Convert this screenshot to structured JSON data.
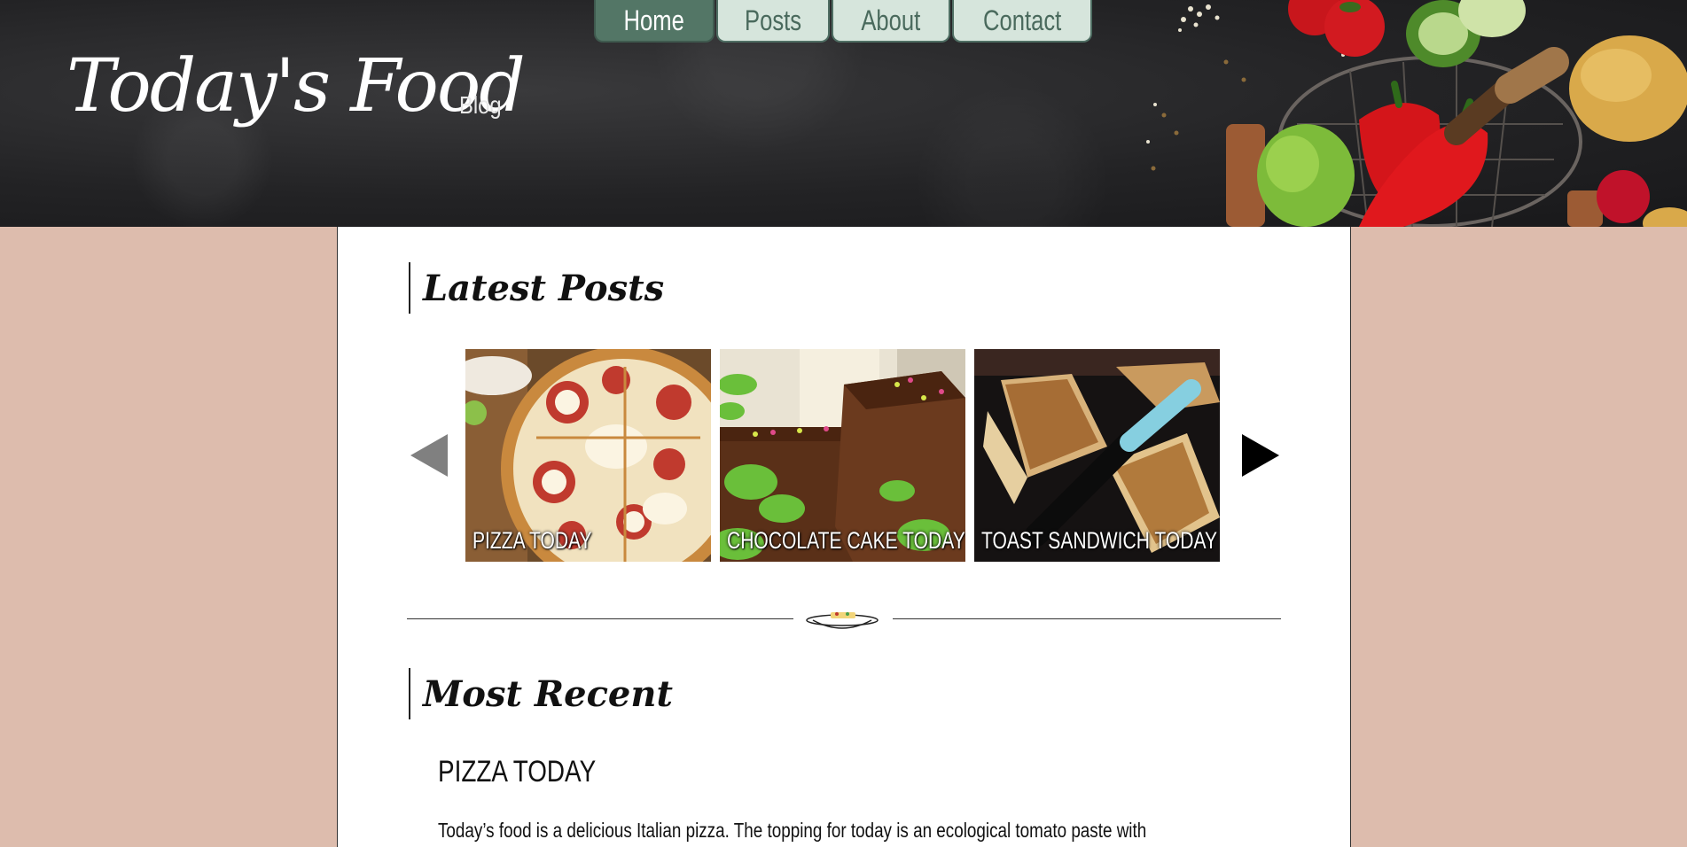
{
  "header": {
    "title": "Today's Food",
    "subtitle": "Blog",
    "nav": [
      {
        "label": "Home",
        "active": true
      },
      {
        "label": "Posts",
        "active": false
      },
      {
        "label": "About",
        "active": false
      },
      {
        "label": "Contact",
        "active": false
      }
    ]
  },
  "latest": {
    "heading": "Latest Posts",
    "posts": [
      {
        "caption": "PIZZA TODAY",
        "image": "pizza-photo"
      },
      {
        "caption": "CHOCOLATE CAKE TODAY",
        "image": "chocolate-cake-photo"
      },
      {
        "caption": "TOAST SANDWICH TODAY",
        "image": "toast-sandwich-photo"
      }
    ]
  },
  "recent": {
    "heading": "Most Recent",
    "post_title": "PIZZA TODAY",
    "excerpt": "Today’s food is a delicious Italian pizza. The topping for today is an ecological tomato paste with"
  },
  "colors": {
    "page_background": "#ddbcad",
    "nav_tab": "#d6e5dc",
    "nav_tab_active": "#537666"
  }
}
